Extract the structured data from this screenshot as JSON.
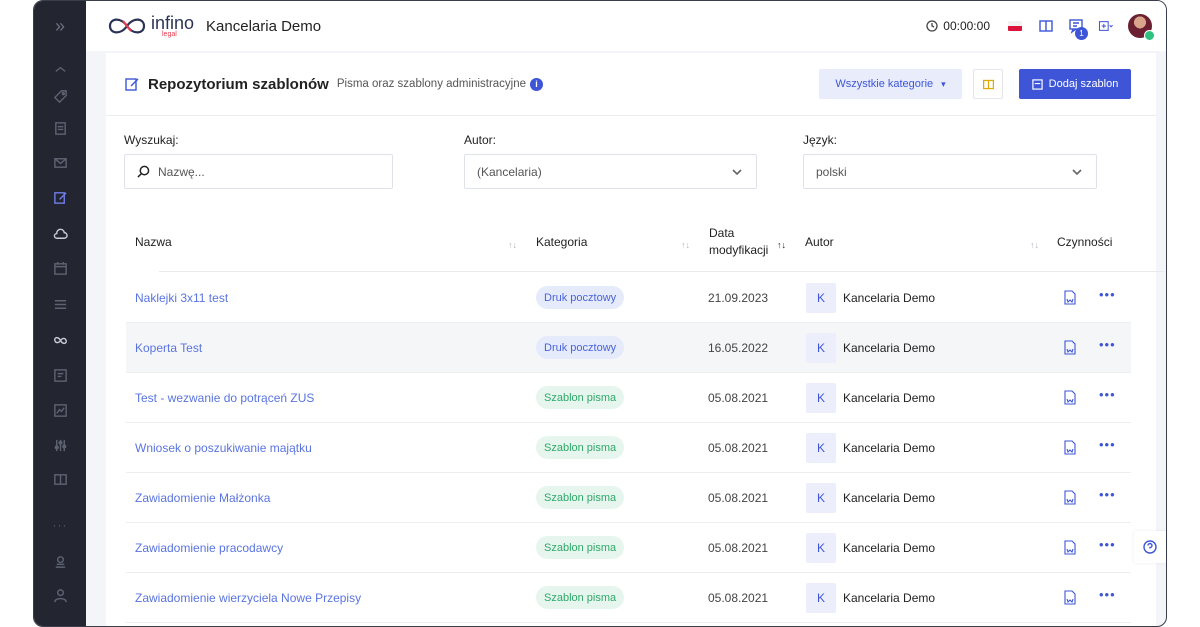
{
  "app": {
    "logo_text": "infino",
    "logo_sub": "legal",
    "title": "Kancelaria Demo"
  },
  "topbar": {
    "timer": "00:00:00",
    "notifications_count": "1"
  },
  "sidebar": {
    "toggle": "»",
    "items": [
      "tag-icon",
      "document-icon",
      "mail-icon",
      "edit-icon",
      "cloud-icon",
      "calendar-icon",
      "list-icon",
      "infinity-icon",
      "invoice-icon",
      "chart-icon",
      "settings-icon",
      "book-icon"
    ],
    "more": "···",
    "bottom": [
      "support-icon",
      "user-icon"
    ]
  },
  "page": {
    "title": "Repozytorium szablonów",
    "subtitle": "Pisma oraz szablony administracyjne",
    "category_button": "Wszystkie kategorie",
    "add_button": "Dodaj szablon"
  },
  "filters": {
    "search_label": "Wyszukaj:",
    "search_placeholder": "Nazwę...",
    "author_label": "Autor:",
    "author_value": "(Kancelaria)",
    "language_label": "Język:",
    "language_value": "polski"
  },
  "table": {
    "headers": {
      "name": "Nazwa",
      "category": "Kategoria",
      "date_line1": "Data",
      "date_line2": "modyfikacji",
      "author": "Autor",
      "actions": "Czynności"
    },
    "rows": [
      {
        "name": "Naklejki 3x11 test",
        "category": "Druk pocztowy",
        "category_type": "druk",
        "date": "21.09.2023",
        "author_initial": "K",
        "author": "Kancelaria Demo"
      },
      {
        "name": "Koperta Test",
        "category": "Druk pocztowy",
        "category_type": "druk",
        "date": "16.05.2022",
        "author_initial": "K",
        "author": "Kancelaria Demo"
      },
      {
        "name": "Test - wezwanie do potrąceń ZUS",
        "category": "Szablon pisma",
        "category_type": "pisma",
        "date": "05.08.2021",
        "author_initial": "K",
        "author": "Kancelaria Demo"
      },
      {
        "name": "Wniosek o poszukiwanie majątku",
        "category": "Szablon pisma",
        "category_type": "pisma",
        "date": "05.08.2021",
        "author_initial": "K",
        "author": "Kancelaria Demo"
      },
      {
        "name": "Zawiadomienie Małżonka",
        "category": "Szablon pisma",
        "category_type": "pisma",
        "date": "05.08.2021",
        "author_initial": "K",
        "author": "Kancelaria Demo"
      },
      {
        "name": "Zawiadomienie pracodawcy",
        "category": "Szablon pisma",
        "category_type": "pisma",
        "date": "05.08.2021",
        "author_initial": "K",
        "author": "Kancelaria Demo"
      },
      {
        "name": "Zawiadomienie wierzyciela Nowe Przepisy",
        "category": "Szablon pisma",
        "category_type": "pisma",
        "date": "05.08.2021",
        "author_initial": "K",
        "author": "Kancelaria Demo"
      }
    ]
  },
  "colors": {
    "accent": "#3d55d6",
    "sidebar": "#232530",
    "druk_tag": "#e6ebfb",
    "pisma_tag": "#e6f6ee"
  }
}
